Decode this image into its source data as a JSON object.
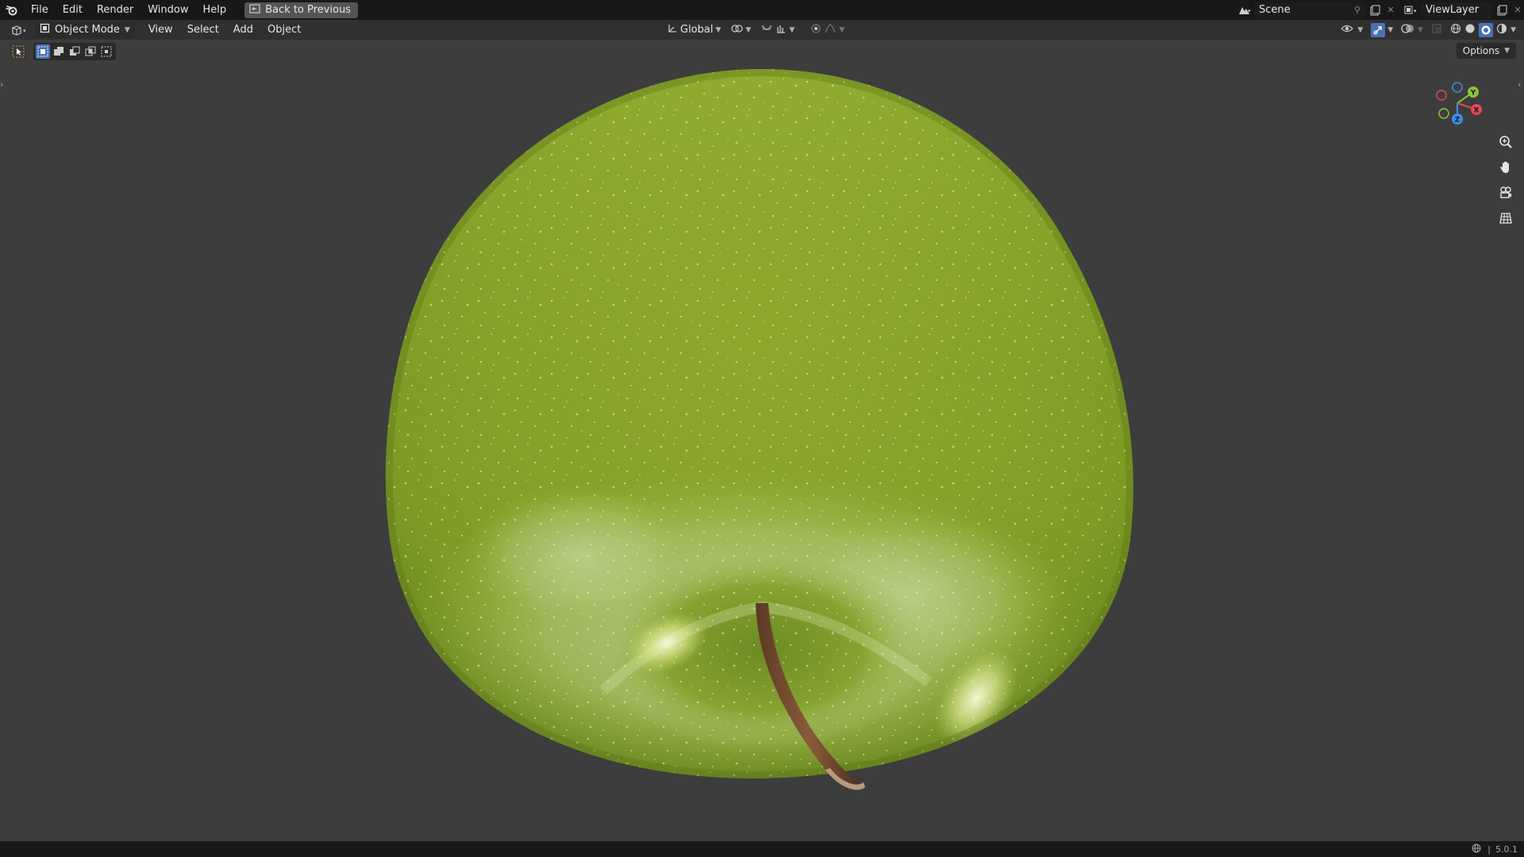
{
  "topbar": {
    "menus": [
      "File",
      "Edit",
      "Render",
      "Window",
      "Help"
    ],
    "back_button": "Back to Previous",
    "scene_name": "Scene",
    "view_layer_name": "ViewLayer"
  },
  "viewport_header": {
    "mode": "Object Mode",
    "menus": [
      "View",
      "Select",
      "Add",
      "Object"
    ],
    "transform_orientation": "Global",
    "options_label": "Options"
  },
  "gizmo": {
    "axes": [
      "X",
      "Y",
      "Z"
    ],
    "colors": {
      "x": "#e0485a",
      "y": "#8ac33b",
      "z": "#3d8ee8"
    }
  },
  "viewport": {
    "object": "green apple"
  },
  "status": {
    "version": "5.0.1"
  },
  "colors": {
    "topbar_bg": "#181818",
    "header_bg": "#303030",
    "viewport_bg": "#3d3d3d",
    "accent": "#4772b3"
  }
}
